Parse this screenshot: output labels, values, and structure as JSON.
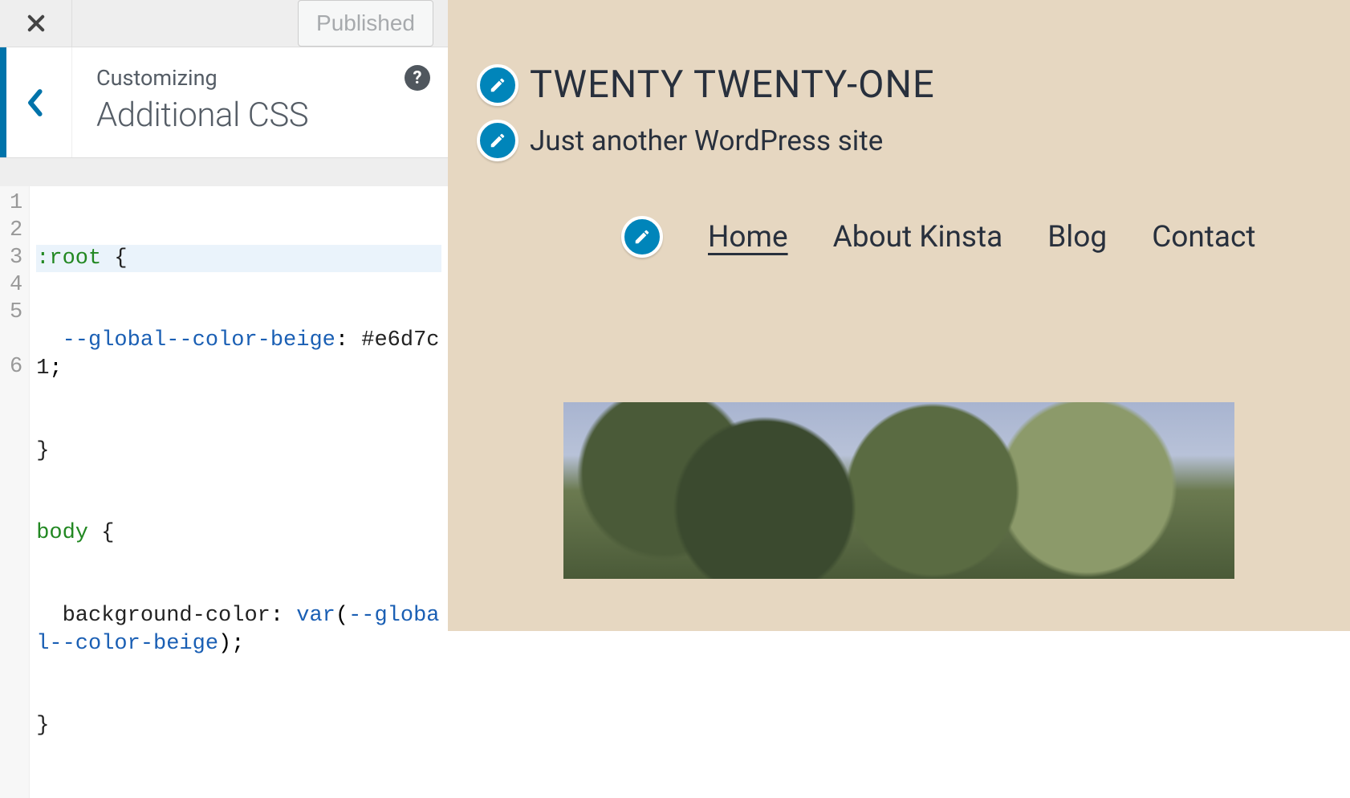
{
  "sidebar": {
    "published_label": "Published",
    "subtitle": "Customizing",
    "title": "Additional CSS",
    "help_symbol": "?"
  },
  "code": {
    "lines": [
      "1",
      "2",
      "3",
      "4",
      "5",
      "6"
    ],
    "l1_a": ":root",
    "l1_b": " {",
    "l2_indent": "  ",
    "l2_var": "--global--color-beige",
    "l2_colon": ": ",
    "l2_val": "#e6d7c1",
    "l2_semi": ";",
    "l3": "}",
    "l4_a": "body",
    "l4_b": " {",
    "l5_indent": "  ",
    "l5_prop": "background-color",
    "l5_colon": ": ",
    "l5_kw": "var",
    "l5_paren": "(",
    "l5_arg": "--global--color-beige",
    "l5_close": ");",
    "l6": "}"
  },
  "preview": {
    "site_title": "TWENTY TWENTY-ONE",
    "tagline": "Just another WordPress site",
    "nav": {
      "home": "Home",
      "about": "About Kinsta",
      "blog": "Blog",
      "contact": "Contact"
    }
  },
  "colors": {
    "accent": "#0073aa",
    "edit_blue": "#0085ba",
    "beige": "#e6d7c1",
    "text": "#28303d"
  }
}
